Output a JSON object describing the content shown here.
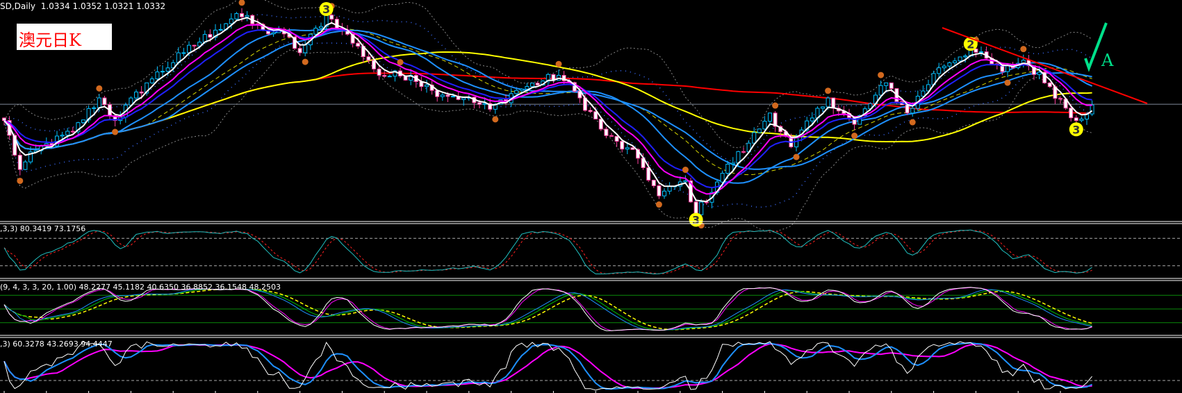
{
  "header": {
    "symbol": "SD,Daily",
    "open": "1.0334",
    "high": "1.0352",
    "low": "1.0321",
    "close": "1.0332"
  },
  "title_label": "澳元日K",
  "panels": {
    "stoch": {
      "label": ",3,3) 80.3419 73.1756"
    },
    "multi": {
      "label": "(9, 4, 3, 3, 20, 1.00) 48.2277 45.1182 40.6350 36.8852 36.1548 48.2503"
    },
    "kdj": {
      "label": ",3) 60.3278 43.2693 94.4447"
    }
  },
  "annotations": {
    "wave1": "3",
    "wave2": "3",
    "wave3": "2",
    "wave4": "3",
    "signal": "A"
  },
  "colors": {
    "bull": "#00bfff",
    "bear": "#ff3fa0",
    "ma_fast": "#ffffff",
    "ma_mid": "#ff00ff",
    "ma_blue": "#2020ff",
    "ma_light": "#1e90ff",
    "ma_yellow": "#ffff00",
    "ma_red": "#ff0000",
    "check": "#00e08a"
  },
  "chart_data": {
    "type": "candlestick",
    "title": "AUDUSD Daily",
    "bars": 207,
    "close_keypoints": [
      [
        0,
        1.027
      ],
      [
        3,
        1.0075
      ],
      [
        6,
        1.015
      ],
      [
        13,
        1.0225
      ],
      [
        18,
        1.036
      ],
      [
        21,
        1.027
      ],
      [
        27,
        1.042
      ],
      [
        34,
        1.054
      ],
      [
        40,
        1.063
      ],
      [
        44,
        1.0696
      ],
      [
        49,
        1.063
      ],
      [
        53,
        1.0615
      ],
      [
        56,
        1.054
      ],
      [
        61,
        1.069
      ],
      [
        64,
        1.063
      ],
      [
        69,
        1.051
      ],
      [
        71,
        1.045
      ],
      [
        77,
        1.045
      ],
      [
        81,
        1.039
      ],
      [
        87,
        1.036
      ],
      [
        92,
        1.0315
      ],
      [
        97,
        1.039
      ],
      [
        105,
        1.045
      ],
      [
        109,
        1.036
      ],
      [
        114,
        1.021
      ],
      [
        120,
        1.012
      ],
      [
        124,
        0.997
      ],
      [
        129,
        1.003
      ],
      [
        131,
        0.9895
      ],
      [
        136,
        1.006
      ],
      [
        141,
        1.018
      ],
      [
        145,
        1.03
      ],
      [
        149,
        1.0165
      ],
      [
        156,
        1.036
      ],
      [
        161,
        1.0255
      ],
      [
        167,
        1.042
      ],
      [
        171,
        1.03
      ],
      [
        177,
        1.048
      ],
      [
        183,
        1.0555
      ],
      [
        189,
        1.0465
      ],
      [
        193,
        1.051
      ],
      [
        198,
        1.0405
      ],
      [
        203,
        1.027
      ],
      [
        206,
        1.0332
      ]
    ],
    "ylim": [
      0.9895,
      1.0714
    ],
    "reference_price": 1.0335,
    "oscillator_levels": {
      "stoch": [
        80,
        20
      ],
      "multi": [
        80,
        50,
        20
      ],
      "kdj": [
        20
      ]
    }
  }
}
